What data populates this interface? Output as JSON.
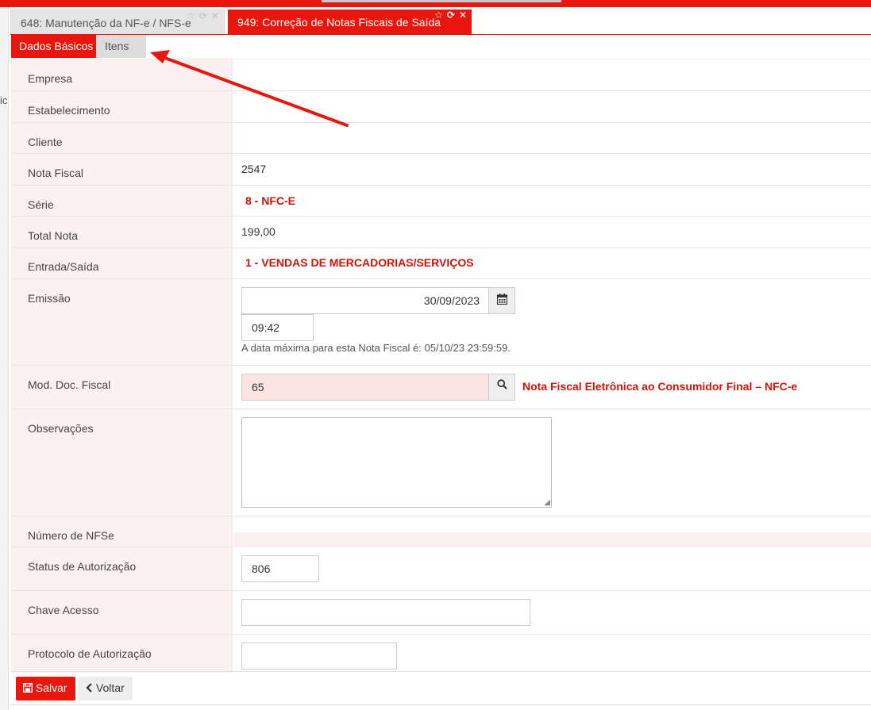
{
  "window_tabs": [
    {
      "label": "648: Manutenção da NF-e / NFS-e",
      "active": false
    },
    {
      "label": "949: Correção de Notas Fiscais de Saída",
      "active": true
    }
  ],
  "tab_icons": {
    "star": "☆",
    "refresh": "⟳",
    "close": "✕"
  },
  "left_rail_text": "ic",
  "subtabs": {
    "basic": "Dados Básicos",
    "items": "Itens"
  },
  "fields": {
    "empresa": {
      "label": "Empresa",
      "value": ""
    },
    "estabelecimento": {
      "label": "Estabelecimento",
      "value": ""
    },
    "cliente": {
      "label": "Cliente",
      "value": ""
    },
    "nota_fiscal": {
      "label": "Nota Fiscal",
      "value": "2547"
    },
    "serie": {
      "label": "Série",
      "value": "8 - NFC-E"
    },
    "total_nota": {
      "label": "Total Nota",
      "value": "199,00"
    },
    "entrada_saida": {
      "label": "Entrada/Saída",
      "value": "1 - VENDAS DE MERCADORIAS/SERVIÇOS"
    },
    "emissao": {
      "label": "Emissão",
      "date": "30/09/2023",
      "time": "09:42",
      "hint": "A data máxima para esta Nota Fiscal é: 05/10/23 23:59:59."
    },
    "mod_doc_fiscal": {
      "label": "Mod. Doc. Fiscal",
      "value": "65",
      "description": "Nota Fiscal Eletrônica ao Consumidor Final – NFC-e"
    },
    "observacoes": {
      "label": "Observações",
      "value": ""
    },
    "numero_nfse": {
      "label": "Número de NFSe",
      "value": ""
    },
    "status_autorizacao": {
      "label": "Status de Autorização",
      "value": "806"
    },
    "chave_acesso": {
      "label": "Chave Acesso",
      "value": ""
    },
    "protocolo_autorizacao": {
      "label": "Protocolo de Autorização",
      "value": ""
    }
  },
  "footer": {
    "save_label": "Salvar",
    "back_label": "Voltar"
  },
  "colors": {
    "accent": "#e8160c",
    "label_bg": "#fdf0f0",
    "highlight_text": "#d0140a"
  }
}
